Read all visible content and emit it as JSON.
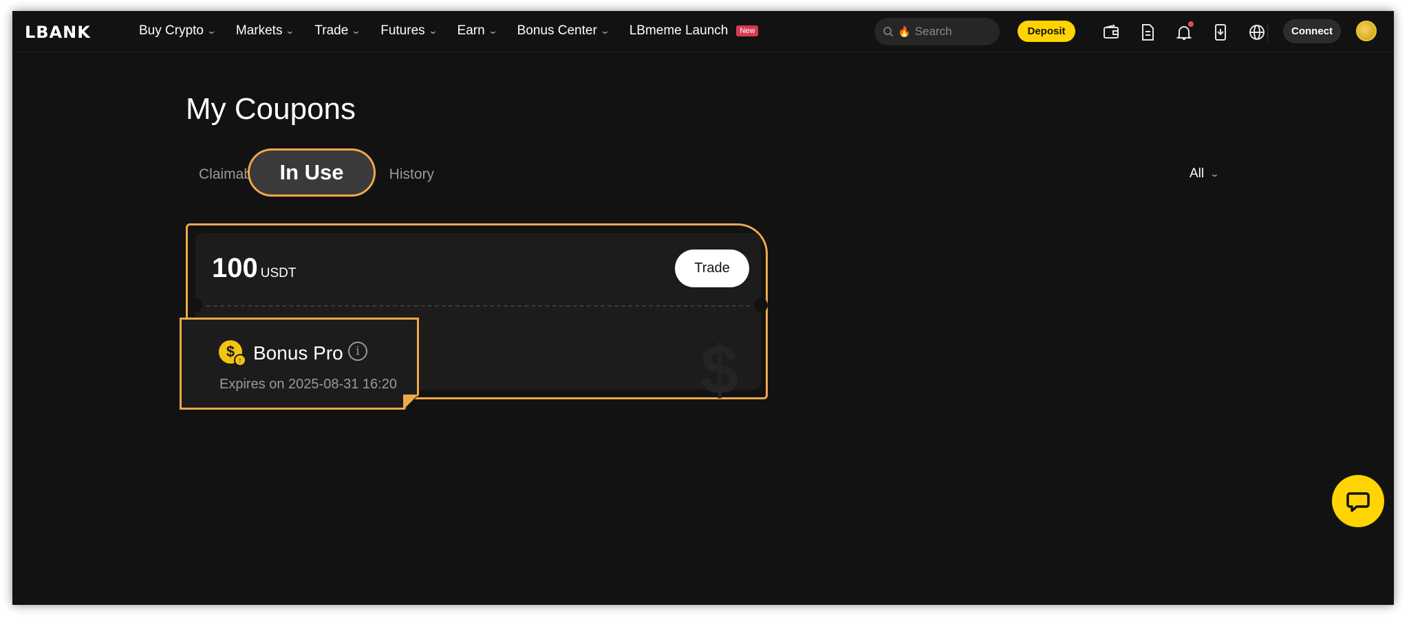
{
  "nav": {
    "logo": "LBANK",
    "menu": [
      {
        "label": "Buy Crypto",
        "has_chevron": true
      },
      {
        "label": "Markets",
        "has_chevron": true
      },
      {
        "label": "Trade",
        "has_chevron": true
      },
      {
        "label": "Futures",
        "has_chevron": true
      },
      {
        "label": "Earn",
        "has_chevron": true
      },
      {
        "label": "Bonus Center",
        "has_chevron": true
      },
      {
        "label": "LBmeme Launch",
        "has_chevron": false
      }
    ],
    "new_badge": "New",
    "search_placeholder": "Search",
    "deposit_label": "Deposit",
    "connect_label": "Connect",
    "icons": [
      "wallet-icon",
      "orders-icon",
      "bell-icon",
      "download-icon",
      "globe-icon"
    ]
  },
  "page": {
    "title": "My Coupons",
    "tabs": {
      "claimable": "Claimable",
      "in_use": "In Use",
      "history": "History"
    },
    "filter_label": "All"
  },
  "coupon": {
    "amount": "100",
    "unit": "USDT",
    "trade_label": "Trade",
    "name": "Bonus Pro",
    "expires": "Expires on 2025-08-31 16:20",
    "watermark": "$"
  },
  "colors": {
    "accent": "#ffd400",
    "highlight": "#f0a94a",
    "background": "#121212",
    "card": "#1c1c1c"
  }
}
